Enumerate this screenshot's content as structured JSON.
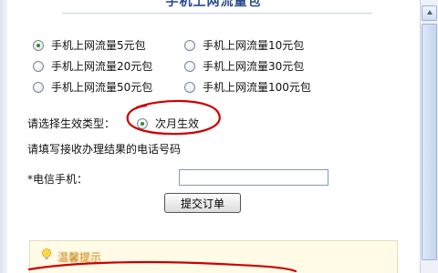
{
  "page": {
    "title": "手机上网流量包"
  },
  "packages": [
    {
      "label": "手机上网流量5元包",
      "checked": true
    },
    {
      "label": "手机上网流量10元包",
      "checked": false
    },
    {
      "label": "手机上网流量20元包",
      "checked": false
    },
    {
      "label": "手机上网流量30元包",
      "checked": false
    },
    {
      "label": "手机上网流量50元包",
      "checked": false
    },
    {
      "label": "手机上网流量100元包",
      "checked": false
    }
  ],
  "effect": {
    "prompt": "请选择生效类型：",
    "option_label": "次月生效",
    "option_checked": true
  },
  "phone": {
    "instruction": "请填写接收办理结果的电话号码",
    "label": "*电信手机：",
    "value": ""
  },
  "submit": {
    "label": "提交订单"
  },
  "tip": {
    "title": "温馨提示"
  },
  "colors": {
    "annotation": "#cc0000",
    "selected_radio": "#2f8a2f",
    "title": "#2a4b8d"
  }
}
